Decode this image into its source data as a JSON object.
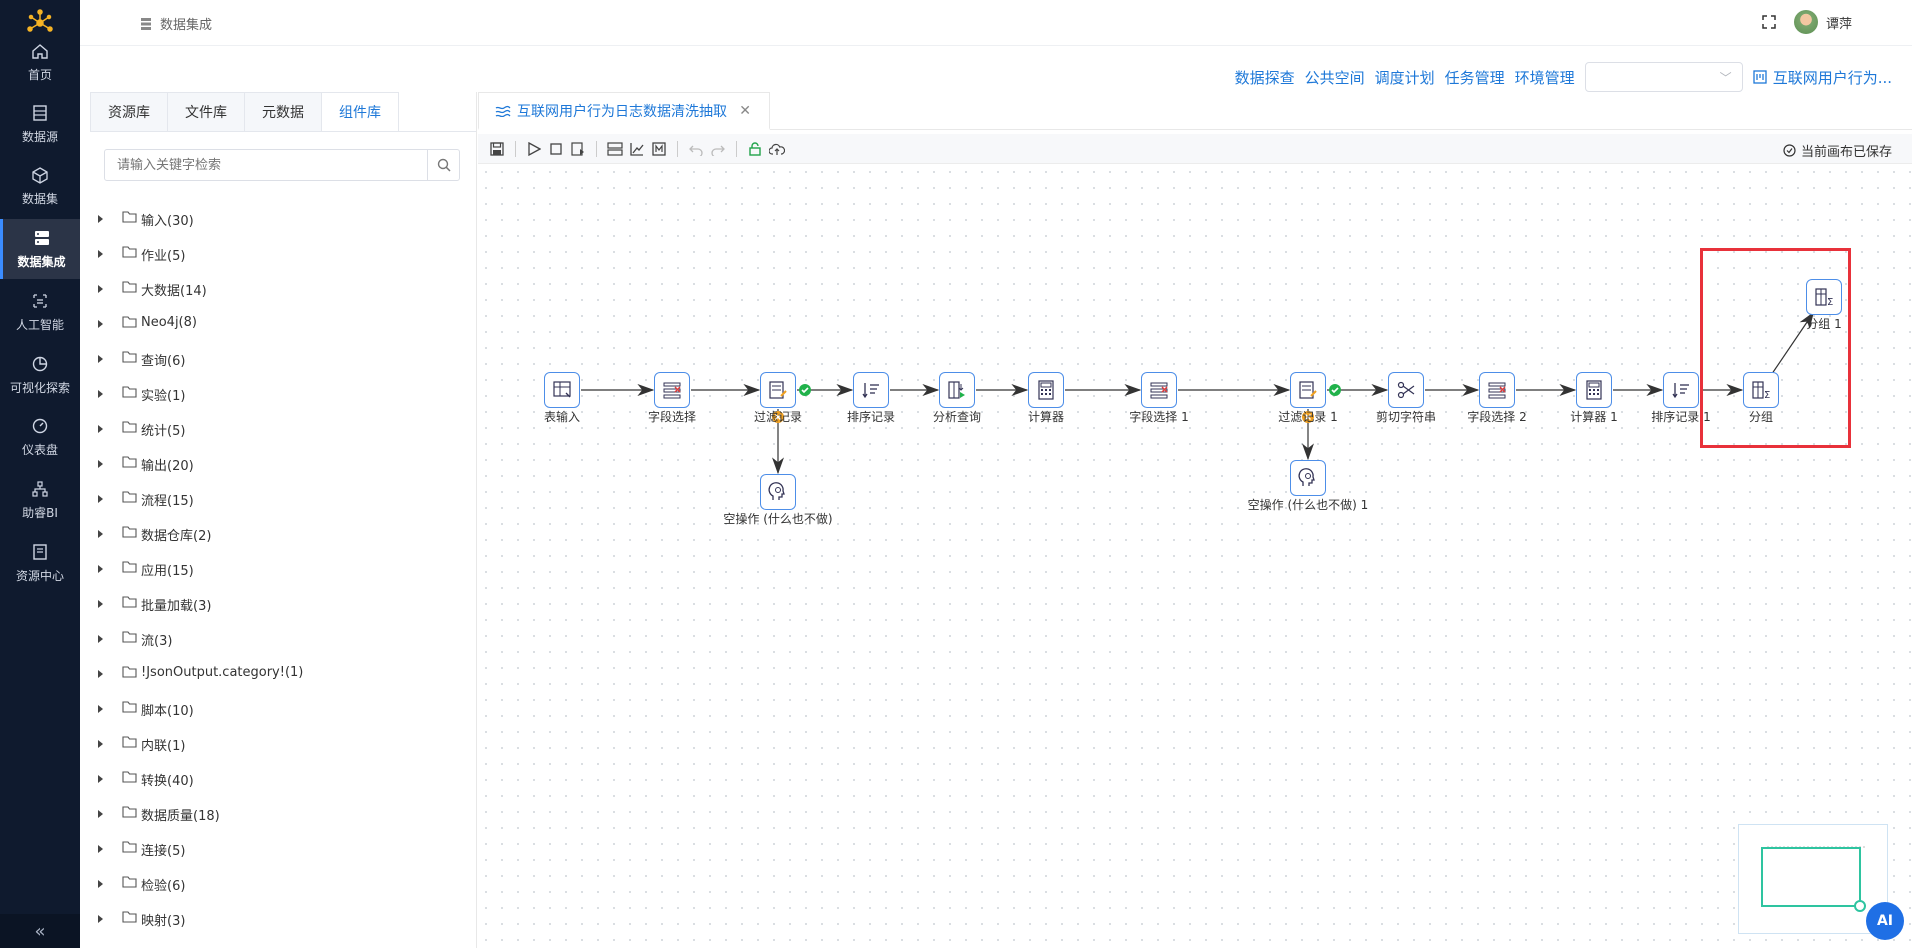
{
  "header": {
    "breadcrumb": "数据集成",
    "user_name": "谭萍"
  },
  "nav": {
    "items": [
      {
        "label": "首页",
        "icon": "home-icon"
      },
      {
        "label": "数据源",
        "icon": "datasource-icon"
      },
      {
        "label": "数据集",
        "icon": "cube-icon"
      },
      {
        "label": "数据集成",
        "icon": "server-icon"
      },
      {
        "label": "人工智能",
        "icon": "ai-icon"
      },
      {
        "label": "可视化探索",
        "icon": "pie-icon"
      },
      {
        "label": "仪表盘",
        "icon": "gauge-icon"
      },
      {
        "label": "助睿BI",
        "icon": "org-icon"
      },
      {
        "label": "资源中心",
        "icon": "book-icon"
      }
    ],
    "active_index": 3
  },
  "top_links": [
    "数据探查",
    "公共空间",
    "调度计划",
    "任务管理",
    "环境管理"
  ],
  "project_link": "互联网用户行为...",
  "left_tabs": [
    "资源库",
    "文件库",
    "元数据",
    "组件库"
  ],
  "left_active_tab": 3,
  "search": {
    "placeholder": "请输入关键字检索"
  },
  "tree": [
    "输入(30)",
    "作业(5)",
    "大数据(14)",
    "Neo4j(8)",
    "查询(6)",
    "实验(1)",
    "统计(5)",
    "输出(20)",
    "流程(15)",
    "数据仓库(2)",
    "应用(15)",
    "批量加载(3)",
    "流(3)",
    "!JsonOutput.category!(1)",
    "脚本(10)",
    "内联(1)",
    "转换(40)",
    "数据质量(18)",
    "连接(5)",
    "检验(6)",
    "映射(3)"
  ],
  "doc_tab": {
    "title": "互联网用户行为日志数据清洗抽取"
  },
  "canvas_status": "当前画布已保存",
  "flow": {
    "nodes": [
      {
        "label": "表输入"
      },
      {
        "label": "字段选择"
      },
      {
        "label": "过滤记录"
      },
      {
        "label": "排序记录"
      },
      {
        "label": "分析查询"
      },
      {
        "label": "计算器"
      },
      {
        "label": "字段选择 1"
      },
      {
        "label": "过滤记录 1"
      },
      {
        "label": "剪切字符串"
      },
      {
        "label": "字段选择 2"
      },
      {
        "label": "计算器 1"
      },
      {
        "label": "排序记录 1"
      },
      {
        "label": "分组"
      },
      {
        "label": "分组 1"
      },
      {
        "label": "空操作 (什么也不做)"
      },
      {
        "label": "空操作 (什么也不做) 1"
      }
    ],
    "colors": {
      "node_border": "#4d8ee8",
      "edge": "#333333",
      "ok": "#21b24b",
      "fail": "#f0a020",
      "highlight": "#e8313a"
    }
  },
  "ai_button": "AI"
}
